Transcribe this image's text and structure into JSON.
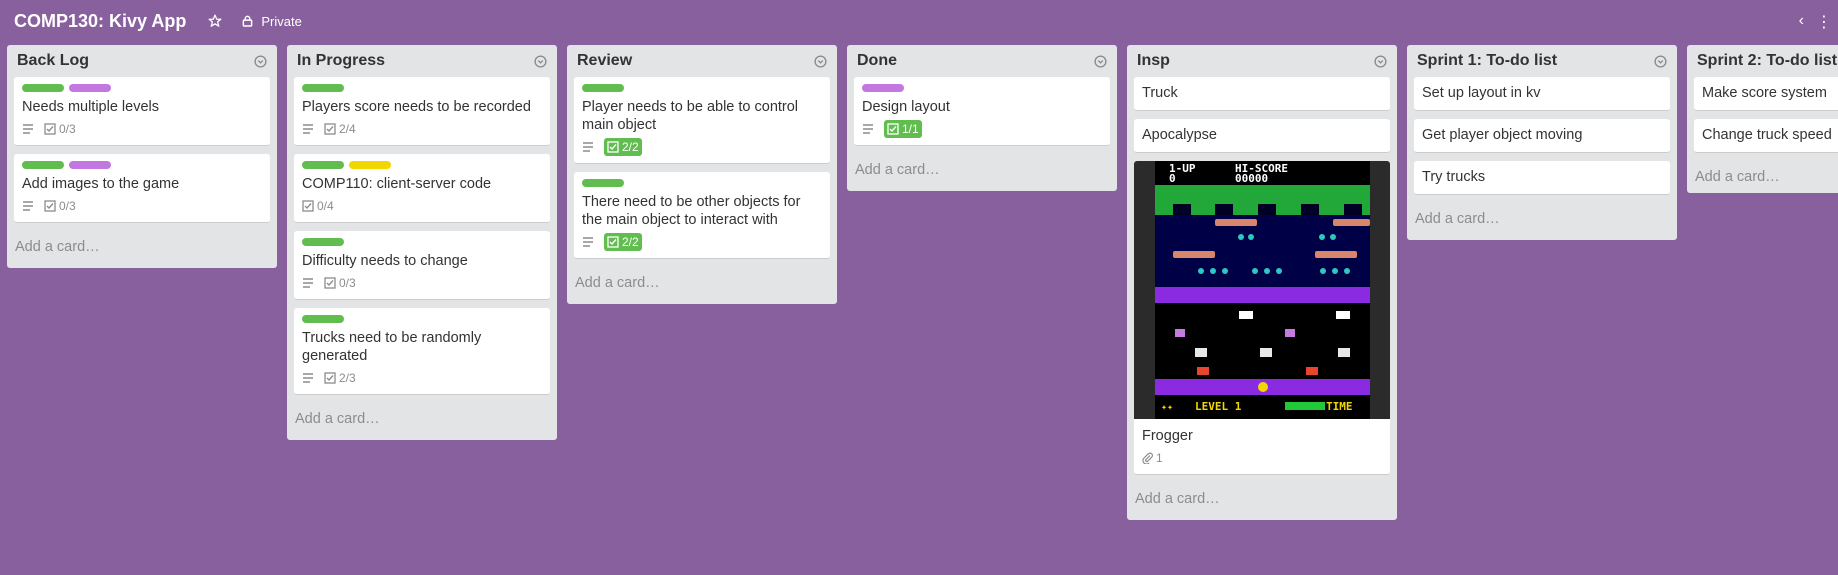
{
  "board": {
    "title": "COMP130: Kivy App",
    "privacy": "Private"
  },
  "colors": {
    "background": "#89609e",
    "list_bg": "#e2e4e6",
    "green": "#61bd4f",
    "purple": "#c377e0",
    "yellow": "#f2d600"
  },
  "lists": [
    {
      "title": "Back Log",
      "add_card": "Add a card…",
      "cards": [
        {
          "labels": [
            "green",
            "purple"
          ],
          "title": "Needs multiple levels",
          "checklist": "0/3"
        },
        {
          "labels": [
            "green",
            "purple"
          ],
          "title": "Add images to the game",
          "checklist": "0/3"
        }
      ]
    },
    {
      "title": "In Progress",
      "add_card": "Add a card…",
      "cards": [
        {
          "labels": [
            "green"
          ],
          "title": "Players score needs to be recorded",
          "checklist": "2/4"
        },
        {
          "labels": [
            "green",
            "yellow"
          ],
          "title": "COMP110: client-server code",
          "checklist": "0/4"
        },
        {
          "labels": [
            "green"
          ],
          "title": "Difficulty needs to change",
          "checklist": "0/3"
        },
        {
          "labels": [
            "green"
          ],
          "title": "Trucks need to be randomly generated",
          "checklist": "2/3"
        }
      ]
    },
    {
      "title": "Review",
      "add_card": "Add a card…",
      "cards": [
        {
          "labels": [
            "green"
          ],
          "title": "Player needs to be able to control main object",
          "checklist": "2/2"
        },
        {
          "labels": [
            "green"
          ],
          "title": "There need to be other objects for the main object to interact with",
          "checklist": "2/2"
        }
      ]
    },
    {
      "title": "Done",
      "add_card": "Add a card…",
      "cards": [
        {
          "labels": [
            "purple"
          ],
          "title": "Design layout",
          "checklist": "1/1"
        }
      ]
    },
    {
      "title": "Insp",
      "add_card": "Add a card…",
      "cards": [
        {
          "title": "Truck"
        },
        {
          "title": "Apocalypse"
        },
        {
          "title": "Frogger",
          "attachments": "1",
          "cover": {
            "score_label": "1-UP",
            "score": "0",
            "hiscore_label": "HI-SCORE",
            "hiscore": "00000",
            "level": "LEVEL 1",
            "time": "TIME"
          }
        }
      ]
    },
    {
      "title": "Sprint 1: To-do list",
      "add_card": "Add a card…",
      "cards": [
        {
          "title": "Set up layout in kv"
        },
        {
          "title": "Get player object moving"
        },
        {
          "title": "Try trucks"
        }
      ]
    },
    {
      "title": "Sprint 2: To-do list",
      "add_card": "Add a card…",
      "cards": [
        {
          "title": "Make score system"
        },
        {
          "title": "Change truck speed"
        }
      ]
    }
  ]
}
